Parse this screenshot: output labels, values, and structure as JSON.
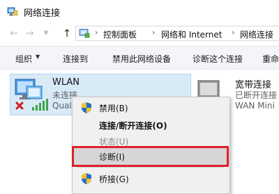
{
  "window": {
    "title": "网络连接"
  },
  "nav": {
    "back_icon": "back-arrow-icon",
    "forward_icon": "forward-arrow-icon",
    "up_icon": "up-arrow-icon",
    "up_glyph": "↑"
  },
  "breadcrumb": {
    "items": [
      "控制面板",
      "网络和 Internet",
      "网络连接"
    ],
    "separator": "›"
  },
  "toolbar": {
    "organize": "组织",
    "connect_to": "连接到",
    "disable_device": "禁用此网络设备",
    "diagnose_connection": "诊断这个连接",
    "rename": "重命"
  },
  "connections": [
    {
      "name": "WLAN",
      "status": "未连接",
      "adapter": "Qualc",
      "icon": "wifi-adapter-icon",
      "selected": true
    },
    {
      "name": "宽带连接",
      "status": "已断开连接",
      "adapter": "WAN Mini",
      "icon": "broadband-adapter-icon",
      "selected": false
    }
  ],
  "context_menu": {
    "items": [
      {
        "label": "禁用(B)",
        "shield": true,
        "bold": false,
        "disabled": false
      },
      {
        "label": "连接/断开连接(O)",
        "shield": false,
        "bold": true,
        "disabled": false
      },
      {
        "label": "状态(U)",
        "shield": false,
        "bold": false,
        "disabled": true
      },
      {
        "label": "诊断(I)",
        "shield": false,
        "bold": false,
        "disabled": false,
        "hovered": true,
        "highlighted": true
      },
      {
        "label": "桥接(G)",
        "shield": true,
        "bold": false,
        "disabled": false
      }
    ]
  },
  "colors": {
    "selection_bg": "#d9eaf7",
    "highlight_border": "#e0202a",
    "shield_blue": "#1f6fd1",
    "shield_yellow": "#f2c12e"
  }
}
